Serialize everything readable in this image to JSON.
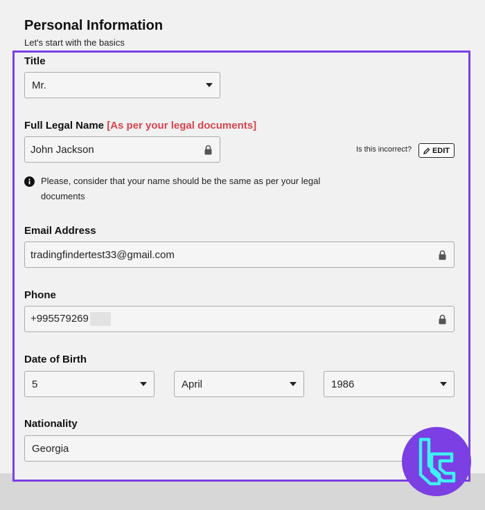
{
  "header": {
    "title": "Personal Information",
    "subtitle": "Let's start with the basics"
  },
  "form": {
    "title_field": {
      "label": "Title",
      "value": "Mr."
    },
    "full_name": {
      "label": "Full Legal Name",
      "required_note": "[As per your legal documents]",
      "value": "John Jackson",
      "incorrect_prompt": "Is this incorrect?",
      "edit_label": "EDIT",
      "info": "Please, consider that your name should be the same as per your legal documents"
    },
    "email": {
      "label": "Email Address",
      "value": "tradingfindertest33@gmail.com"
    },
    "phone": {
      "label": "Phone",
      "value": "+995579269"
    },
    "dob": {
      "label": "Date of Birth",
      "day": "5",
      "month": "April",
      "year": "1986"
    },
    "nationality": {
      "label": "Nationality",
      "value": "Georgia"
    }
  },
  "colors": {
    "accent_frame": "#7b3fe4",
    "required_text": "#d9434f",
    "logo_bg": "#7b3fe4",
    "logo_mark": "#3ff0f5"
  },
  "icons": [
    "chevron-down-icon",
    "lock-icon",
    "pencil-icon",
    "info-icon",
    "brand-logo-icon"
  ]
}
